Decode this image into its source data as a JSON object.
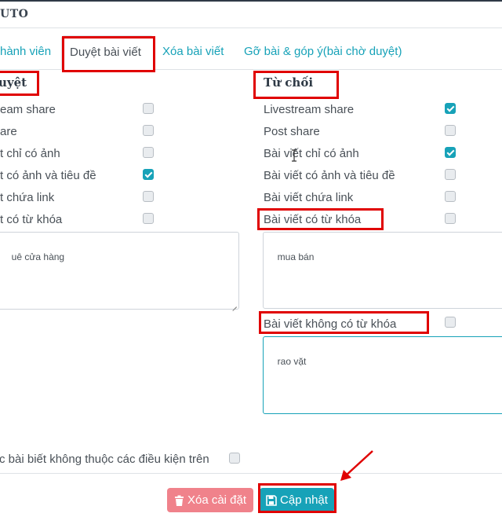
{
  "header": {
    "title": "UTO"
  },
  "tabs": [
    {
      "label": "hành viên"
    },
    {
      "label": "Duyệt bài viết"
    },
    {
      "label": "Xóa bài viết"
    },
    {
      "label": "Gỡ bài & góp ý(bài chờ duyệt)"
    }
  ],
  "left_column": {
    "title": "uyệt",
    "rows": [
      {
        "label": "eam share",
        "checked": false
      },
      {
        "label": "are",
        "checked": false
      },
      {
        "label": "t chỉ có ảnh",
        "checked": false
      },
      {
        "label": "t có ảnh và tiêu đề",
        "checked": true
      },
      {
        "label": "t chứa link",
        "checked": false
      },
      {
        "label": "t có từ khóa",
        "checked": false
      }
    ],
    "keywords_text": "uê cửa hàng"
  },
  "right_column": {
    "title": "Từ chối",
    "rows": [
      {
        "label": "Livestream share",
        "checked": true
      },
      {
        "label": "Post share",
        "checked": false
      },
      {
        "label": "Bài viết chỉ có ảnh",
        "checked": true
      },
      {
        "label": "Bài viết có ảnh và tiêu đề",
        "checked": false
      },
      {
        "label": "Bài viết chứa link",
        "checked": false
      },
      {
        "label": "Bài viết có từ khóa",
        "checked": false
      }
    ],
    "keywords_text": "mua bán",
    "no_keyword_label": "Bài viết không có từ khóa",
    "no_keyword_checked": false,
    "no_keyword_text": "rao vặt"
  },
  "other_condition": {
    "label": "c bài biết không thuộc các điều kiện trên",
    "checked": false
  },
  "buttons": {
    "delete_label": "Xóa cài đặt",
    "update_label": "Cập nhật"
  },
  "colors": {
    "accent": "#17a2b8",
    "danger": "#f0828b",
    "annotation": "#e00000"
  }
}
